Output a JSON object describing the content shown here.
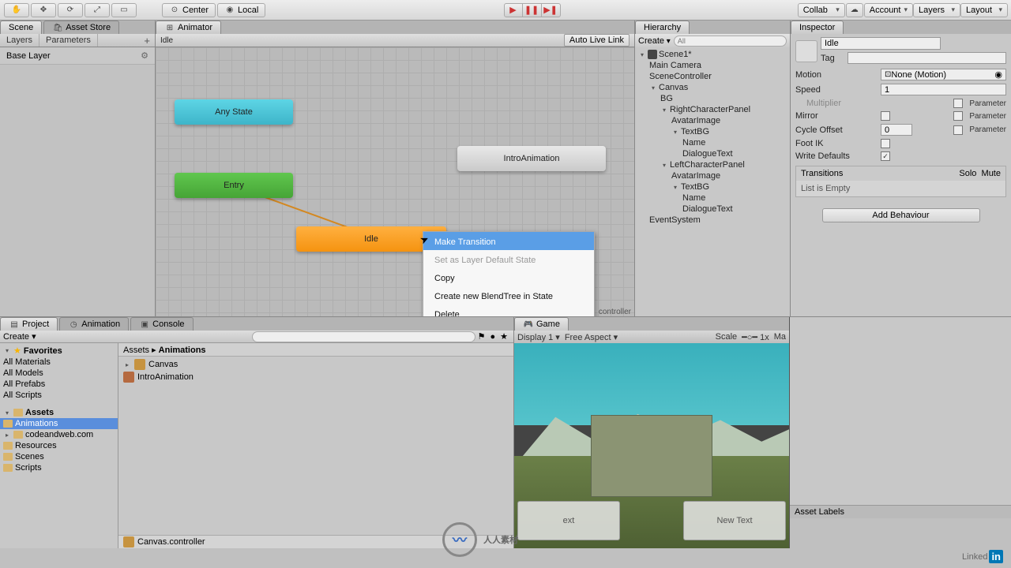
{
  "toolbar": {
    "center_label": "Center",
    "local_label": "Local",
    "collab_label": "Collab",
    "account_label": "Account",
    "layers_label": "Layers",
    "layout_label": "Layout"
  },
  "panels": {
    "scene_tab": "Scene",
    "asset_store_tab": "Asset Store",
    "animator_tab": "Animator",
    "hierarchy_tab": "Hierarchy",
    "inspector_tab": "Inspector",
    "project_tab": "Project",
    "animation_tab": "Animation",
    "console_tab": "Console",
    "game_tab": "Game"
  },
  "animator": {
    "layers_tab": "Layers",
    "parameters_tab": "Parameters",
    "base_layer": "Base Layer",
    "crumb": "Idle",
    "auto_live_link": "Auto Live Link",
    "nodes": {
      "any_state": "Any State",
      "entry": "Entry",
      "idle": "Idle",
      "intro": "IntroAnimation"
    },
    "controller_path": "controller"
  },
  "context_menu": {
    "make_transition": "Make Transition",
    "set_default": "Set as Layer Default State",
    "copy": "Copy",
    "create_blendtree": "Create new BlendTree in State",
    "delete": "Delete"
  },
  "hierarchy": {
    "create_label": "Create",
    "search_placeholder": "All",
    "scene": "Scene1*",
    "items": {
      "main_camera": "Main Camera",
      "scene_controller": "SceneController",
      "canvas": "Canvas",
      "bg": "BG",
      "right_char": "RightCharacterPanel",
      "avatar_img": "AvatarImage",
      "text_bg": "TextBG",
      "name": "Name",
      "dialogue": "DialogueText",
      "left_char": "LeftCharacterPanel",
      "event_system": "EventSystem"
    }
  },
  "inspector": {
    "state_name": "Idle",
    "tag_label": "Tag",
    "motion_label": "Motion",
    "motion_value": "None (Motion)",
    "speed_label": "Speed",
    "speed_value": "1",
    "multiplier_label": "Multiplier",
    "parameter_label": "Parameter",
    "mirror_label": "Mirror",
    "cycle_offset_label": "Cycle Offset",
    "cycle_offset_value": "0",
    "foot_ik_label": "Foot IK",
    "write_defaults_label": "Write Defaults",
    "transitions_label": "Transitions",
    "solo_label": "Solo",
    "mute_label": "Mute",
    "list_empty": "List is Empty",
    "add_behaviour": "Add Behaviour",
    "asset_labels": "Asset Labels"
  },
  "project": {
    "create_label": "Create",
    "favorites": "Favorites",
    "fav_items": [
      "All Materials",
      "All Models",
      "All Prefabs",
      "All Scripts"
    ],
    "assets": "Assets",
    "folders": [
      "Animations",
      "codeandweb.com",
      "Resources",
      "Scenes",
      "Scripts"
    ],
    "breadcrumb_root": "Assets",
    "breadcrumb_current": "Animations",
    "files": [
      "Canvas",
      "IntroAnimation"
    ],
    "footer": "Canvas.controller"
  },
  "game": {
    "display": "Display 1",
    "aspect": "Free Aspect",
    "scale_label": "Scale",
    "scale_value": "1x",
    "max_label": "Ma",
    "new_text": "New Text",
    "ext": "ext"
  },
  "brand": {
    "linked": "Linked",
    "in": "in",
    "center": "人人素材"
  }
}
